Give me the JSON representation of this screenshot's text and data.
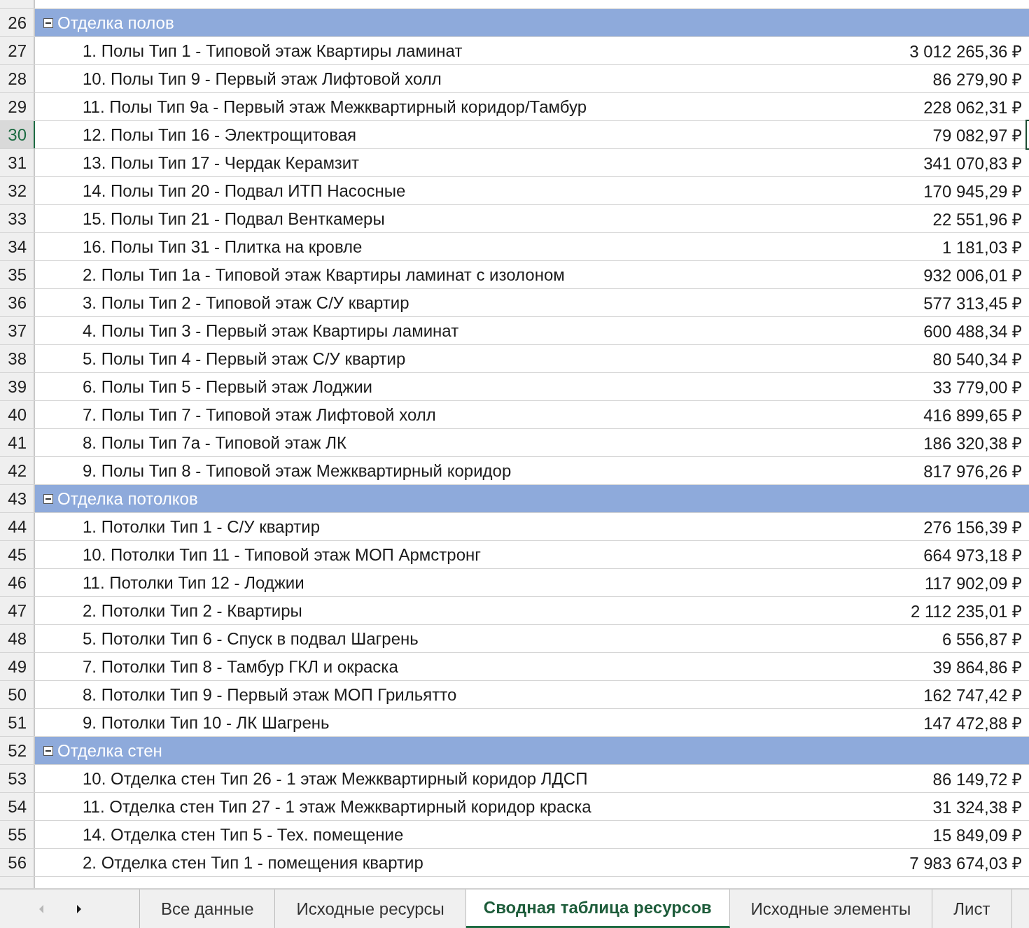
{
  "groups": [
    {
      "row": "26",
      "label": "Отделка полов",
      "expanded": true,
      "selected": false,
      "items": [
        {
          "row": "27",
          "name": "1. Полы Тип 1 - Типовой этаж Квартиры ламинат",
          "value": "3 012 265,36 ₽",
          "selected": false
        },
        {
          "row": "28",
          "name": "10. Полы Тип 9 - Первый этаж Лифтовой холл",
          "value": "86 279,90 ₽",
          "selected": false
        },
        {
          "row": "29",
          "name": "11. Полы Тип 9а - Первый этаж Межквартирный коридор/Тамбур",
          "value": "228 062,31 ₽",
          "selected": false
        },
        {
          "row": "30",
          "name": "12. Полы Тип 16 - Электрощитовая",
          "value": "79 082,97 ₽",
          "selected": true
        },
        {
          "row": "31",
          "name": "13. Полы Тип 17 - Чердак Керамзит",
          "value": "341 070,83 ₽",
          "selected": false
        },
        {
          "row": "32",
          "name": "14. Полы Тип 20 - Подвал ИТП Насосные",
          "value": "170 945,29 ₽",
          "selected": false
        },
        {
          "row": "33",
          "name": "15. Полы Тип 21 - Подвал Венткамеры",
          "value": "22 551,96 ₽",
          "selected": false
        },
        {
          "row": "34",
          "name": "16. Полы Тип 31 - Плитка на кровле",
          "value": "1 181,03 ₽",
          "selected": false
        },
        {
          "row": "35",
          "name": "2. Полы Тип 1а - Типовой этаж Квартиры ламинат с изолоном",
          "value": "932 006,01 ₽",
          "selected": false
        },
        {
          "row": "36",
          "name": "3. Полы Тип 2 - Типовой этаж С/У квартир",
          "value": "577 313,45 ₽",
          "selected": false
        },
        {
          "row": "37",
          "name": "4. Полы Тип 3 - Первый этаж Квартиры ламинат",
          "value": "600 488,34 ₽",
          "selected": false
        },
        {
          "row": "38",
          "name": "5. Полы Тип 4 - Первый этаж С/У квартир",
          "value": "80 540,34 ₽",
          "selected": false
        },
        {
          "row": "39",
          "name": "6. Полы Тип 5 - Первый этаж Лоджии",
          "value": "33 779,00 ₽",
          "selected": false
        },
        {
          "row": "40",
          "name": "7. Полы Тип 7 - Типовой этаж Лифтовой холл",
          "value": "416 899,65 ₽",
          "selected": false
        },
        {
          "row": "41",
          "name": "8. Полы Тип 7а - Типовой этаж ЛК",
          "value": "186 320,38 ₽",
          "selected": false
        },
        {
          "row": "42",
          "name": "9. Полы Тип 8 - Типовой этаж Межквартирный коридор",
          "value": "817 976,26 ₽",
          "selected": false
        }
      ]
    },
    {
      "row": "43",
      "label": "Отделка потолков",
      "expanded": true,
      "selected": false,
      "items": [
        {
          "row": "44",
          "name": "1. Потолки Тип 1 - С/У квартир",
          "value": "276 156,39 ₽",
          "selected": false
        },
        {
          "row": "45",
          "name": "10. Потолки Тип 11 - Типовой этаж МОП Армстронг",
          "value": "664 973,18 ₽",
          "selected": false
        },
        {
          "row": "46",
          "name": "11. Потолки Тип 12 - Лоджии",
          "value": "117 902,09 ₽",
          "selected": false
        },
        {
          "row": "47",
          "name": "2. Потолки Тип 2 - Квартиры",
          "value": "2 112 235,01 ₽",
          "selected": false
        },
        {
          "row": "48",
          "name": "5. Потолки Тип 6 - Спуск в подвал Шагрень",
          "value": "6 556,87 ₽",
          "selected": false
        },
        {
          "row": "49",
          "name": "7. Потолки Тип 8 - Тамбур ГКЛ и окраска",
          "value": "39 864,86 ₽",
          "selected": false
        },
        {
          "row": "50",
          "name": "8. Потолки Тип 9 - Первый этаж МОП Грильятто",
          "value": "162 747,42 ₽",
          "selected": false
        },
        {
          "row": "51",
          "name": "9. Потолки Тип 10 - ЛК Шагрень",
          "value": "147 472,88 ₽",
          "selected": false
        }
      ]
    },
    {
      "row": "52",
      "label": "Отделка стен",
      "expanded": true,
      "selected": false,
      "items": [
        {
          "row": "53",
          "name": "10. Отделка стен Тип 26 - 1 этаж Межквартирный коридор ЛДСП",
          "value": "86 149,72 ₽",
          "selected": false
        },
        {
          "row": "54",
          "name": "11. Отделка стен Тип 27 - 1 этаж Межквартирный коридор краска",
          "value": "31 324,38 ₽",
          "selected": false
        },
        {
          "row": "55",
          "name": "14. Отделка стен Тип 5 - Тех. помещение",
          "value": "15 849,09 ₽",
          "selected": false
        },
        {
          "row": "56",
          "name": "2. Отделка стен Тип 1 - помещения квартир",
          "value": "7 983 674,03 ₽",
          "selected": false
        }
      ]
    }
  ],
  "sheet_nav": [
    {
      "kind": "prev",
      "disabled": true
    },
    {
      "kind": "next",
      "disabled": false
    }
  ],
  "tabs": [
    {
      "label": "Все данные",
      "selected": false
    },
    {
      "label": "Исходные ресурсы",
      "selected": false
    },
    {
      "label": "Сводная таблица ресурсов",
      "selected": true
    },
    {
      "label": "Исходные элементы",
      "selected": false
    },
    {
      "label": "Лист",
      "selected": false
    }
  ]
}
